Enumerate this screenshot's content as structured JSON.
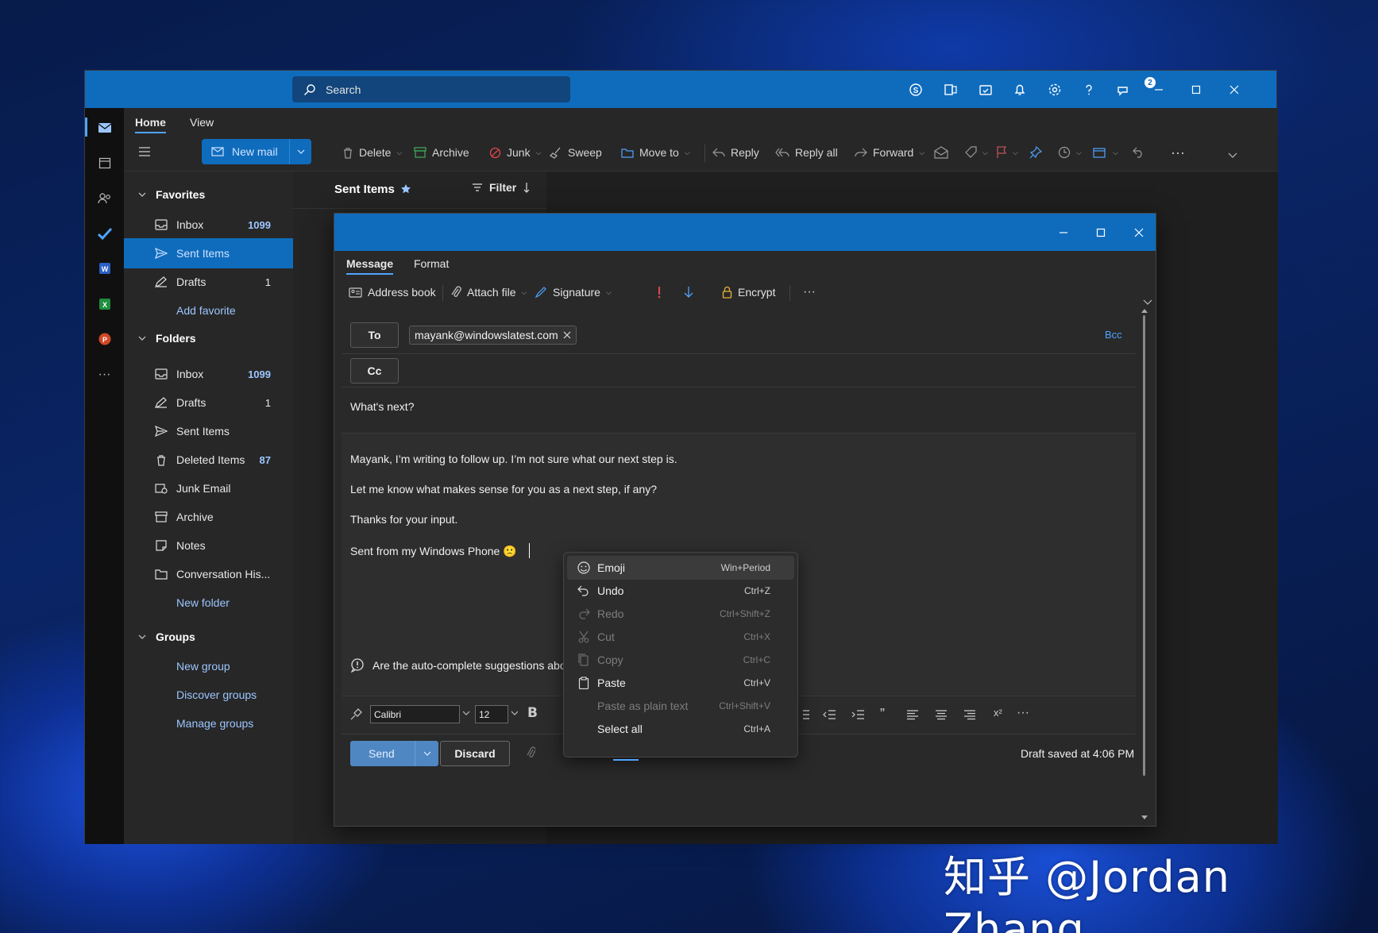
{
  "titlebar": {
    "search_placeholder": "Search",
    "notification_badge": "2"
  },
  "ribbon": {
    "tabs": [
      "Home",
      "View"
    ],
    "new_mail": "New mail",
    "commands": {
      "delete": "Delete",
      "archive": "Archive",
      "junk": "Junk",
      "sweep": "Sweep",
      "move_to": "Move to",
      "reply": "Reply",
      "reply_all": "Reply all",
      "forward": "Forward"
    }
  },
  "nav": {
    "favorites": {
      "header": "Favorites",
      "items": [
        {
          "label": "Inbox",
          "count": "1099"
        },
        {
          "label": "Sent Items",
          "count": ""
        },
        {
          "label": "Drafts",
          "count": "1"
        }
      ],
      "add_favorite": "Add favorite"
    },
    "folders": {
      "header": "Folders",
      "items": [
        {
          "label": "Inbox",
          "count": "1099"
        },
        {
          "label": "Drafts",
          "count": "1"
        },
        {
          "label": "Sent Items",
          "count": ""
        },
        {
          "label": "Deleted Items",
          "count": "87"
        },
        {
          "label": "Junk Email",
          "count": ""
        },
        {
          "label": "Archive",
          "count": ""
        },
        {
          "label": "Notes",
          "count": ""
        },
        {
          "label": "Conversation His...",
          "count": ""
        }
      ],
      "new_folder": "New folder"
    },
    "groups": {
      "header": "Groups",
      "new_group": "New group",
      "discover": "Discover groups",
      "manage": "Manage groups"
    }
  },
  "list": {
    "title": "Sent Items",
    "filter": "Filter"
  },
  "compose": {
    "tabs": [
      "Message",
      "Format"
    ],
    "commands": {
      "address_book": "Address book",
      "attach_file": "Attach file",
      "signature": "Signature",
      "encrypt": "Encrypt"
    },
    "to_label": "To",
    "cc_label": "Cc",
    "bcc_label": "Bcc",
    "recipient": "mayank@windowslatest.com",
    "subject": "What's next?",
    "body_lines": [
      "Mayank, I’m writing to follow up. I’m not sure what our next step is.",
      "Let me know what makes sense for you as a next step, if any?",
      "Thanks for your input.",
      "Sent from my Windows Phone 🙁"
    ],
    "feedback": "Are the auto-complete suggestions abo",
    "font": "Calibri",
    "font_size": "12",
    "send": "Send",
    "discard": "Discard",
    "draft_status": "Draft saved at 4:06 PM"
  },
  "context_menu": [
    {
      "label": "Emoji",
      "shortcut": "Win+Period",
      "enabled": true
    },
    {
      "label": "Undo",
      "shortcut": "Ctrl+Z",
      "enabled": true
    },
    {
      "label": "Redo",
      "shortcut": "Ctrl+Shift+Z",
      "enabled": false
    },
    {
      "label": "Cut",
      "shortcut": "Ctrl+X",
      "enabled": false
    },
    {
      "label": "Copy",
      "shortcut": "Ctrl+C",
      "enabled": false
    },
    {
      "label": "Paste",
      "shortcut": "Ctrl+V",
      "enabled": true
    },
    {
      "label": "Paste as plain text",
      "shortcut": "Ctrl+Shift+V",
      "enabled": false
    },
    {
      "label": "Select all",
      "shortcut": "Ctrl+A",
      "enabled": true
    }
  ],
  "watermark": "知乎 @Jordan Zhang",
  "colors": {
    "accent": "#0f6cbd",
    "link": "#9cc6ff",
    "background": "#1f1f1f"
  }
}
